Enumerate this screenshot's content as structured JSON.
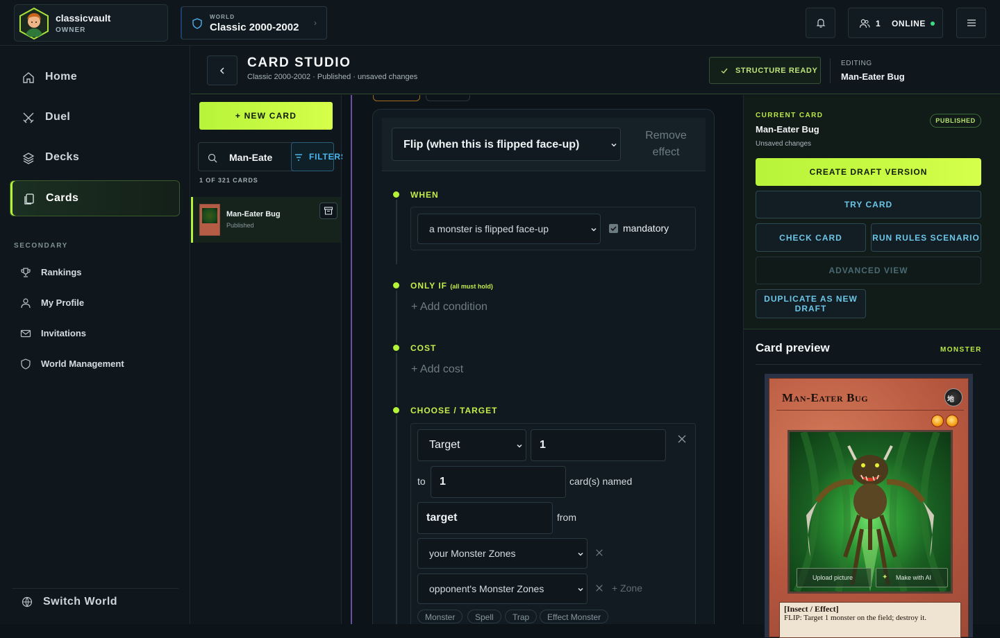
{
  "user": {
    "name": "classicvault",
    "role": "OWNER"
  },
  "world": {
    "eyebrow": "WORLD",
    "name": "Classic 2000-2002"
  },
  "header": {
    "online_count": "1",
    "online_label": "ONLINE"
  },
  "nav": {
    "main": [
      {
        "label": "Home",
        "icon": "home-icon"
      },
      {
        "label": "Duel",
        "icon": "swords-icon"
      },
      {
        "label": "Decks",
        "icon": "layers-icon"
      },
      {
        "label": "Cards",
        "icon": "cards-icon",
        "active": true
      }
    ],
    "secondary_label": "SECONDARY",
    "secondary": [
      {
        "label": "Rankings",
        "icon": "trophy-icon"
      },
      {
        "label": "My Profile",
        "icon": "user-icon"
      },
      {
        "label": "Invitations",
        "icon": "mail-icon"
      },
      {
        "label": "World Management",
        "icon": "shield-icon"
      }
    ],
    "switch_world": "Switch World"
  },
  "studio": {
    "title": "CARD STUDIO",
    "subtitle": "Classic 2000-2002 · Published · unsaved changes",
    "structure_badge": "STRUCTURE READY",
    "editing_label": "EDITING",
    "editing_value": "Man-Eater Bug"
  },
  "list": {
    "new_card": "+ NEW CARD",
    "search_value": "Man-Eate",
    "filters": "FILTERS",
    "count": "1 OF 321 CARDS",
    "items": [
      {
        "name": "Man-Eater Bug",
        "status": "Published"
      }
    ]
  },
  "editor": {
    "trigger": "Flip (when this is flipped face-up)",
    "remove_effect": "Remove effect",
    "when": {
      "title": "WHEN",
      "event": "a monster is flipped face-up",
      "mandatory_label": "mandatory",
      "mandatory": true
    },
    "only_if": {
      "title": "ONLY IF",
      "hint": "(all must hold)",
      "add": "+ Add condition"
    },
    "cost": {
      "title": "COST",
      "add": "+ Add cost"
    },
    "choose": {
      "title": "CHOOSE / TARGET",
      "mode": "Target",
      "min": "1",
      "to_label": "to",
      "max": "1",
      "named_label": "card(s) named",
      "name_value": "target",
      "from_label": "from",
      "zones": [
        "your Monster Zones",
        "opponent's Monster Zones"
      ],
      "add_zone": "+ Zone",
      "filters": [
        "Monster",
        "Spell",
        "Trap",
        "Effect Monster"
      ]
    }
  },
  "right": {
    "eyebrow": "CURRENT CARD",
    "card_name": "Man-Eater Bug",
    "unsaved": "Unsaved changes",
    "status_badge": "PUBLISHED",
    "create_draft": "CREATE DRAFT VERSION",
    "try_card": "TRY CARD",
    "check_card": "CHECK CARD",
    "run_rules": "RUN RULES SCENARIO",
    "advanced_view": "ADVANCED VIEW",
    "duplicate": "DUPLICATE AS NEW DRAFT",
    "preview_title": "Card preview",
    "preview_type": "MONSTER"
  },
  "card": {
    "name": "Man-Eater Bug",
    "attribute": "地",
    "level": 2,
    "upload_picture": "Upload picture",
    "make_with_ai": "Make with AI",
    "type_line": "[Insect / Effect]",
    "effect": "FLIP: Target 1 monster on the field; destroy it."
  },
  "colors": {
    "accent": "#b5f23a",
    "info": "#48b7f0",
    "success": "#3ddc84"
  }
}
